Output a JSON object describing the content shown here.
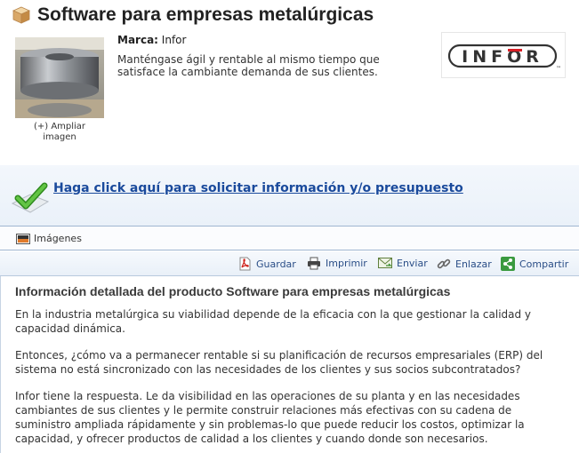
{
  "header": {
    "title": "Software para empresas metalúrgicas"
  },
  "product": {
    "enlarge_line1": "(+) Ampliar",
    "enlarge_line2": "imagen",
    "brand_label": "Marca:",
    "brand_value": "Infor",
    "description": "Manténgase ágil y rentable al mismo tiempo que satisface la cambiante demanda de sus clientes.",
    "logo_text": "INFOR",
    "logo_tm": "™"
  },
  "cta": {
    "label": "Haga click aquí para solicitar información y/o presupuesto"
  },
  "tabs": {
    "images_label": "Imágenes"
  },
  "toolbar": {
    "save": "Guardar",
    "print": "Imprimir",
    "send": "Enviar",
    "link": "Enlazar",
    "share": "Compartir"
  },
  "details": {
    "title": "Información detallada del producto Software para empresas metalúrgicas",
    "paragraphs": [
      "En la industria metalúrgica su viabilidad depende de la eficacia con la que gestionar la calidad y capacidad dinámica.",
      "Entonces, ¿cómo va a permanecer rentable si su planificación de recursos empresariales (ERP) del sistema no está sincronizado con las necesidades de los clientes y sus socios subcontratados?",
      "Infor tiene la respuesta. Le da visibilidad en las operaciones de su planta y en las necesidades cambiantes de sus clientes y le permite construir relaciones más efectivas con su cadena de suministro ampliada rápidamente y sin problemas-lo que puede reducir los costos, optimizar la capacidad, y ofrecer productos de calidad a los clientes y cuando donde son necesarios."
    ]
  },
  "colors": {
    "link_blue": "#1a4a9c",
    "logo_red": "#d81f26",
    "check_green": "#3fa22a"
  },
  "icons": {
    "title": "box-icon",
    "cta": "checkmark-icon",
    "images": "image-icon",
    "save": "pdf-icon",
    "print": "printer-icon",
    "send": "email-icon",
    "link": "link-icon",
    "share": "share-icon"
  }
}
